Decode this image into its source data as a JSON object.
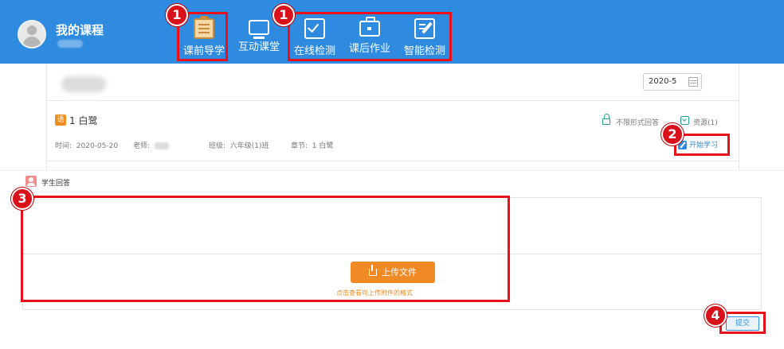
{
  "header": {
    "title": "我的课程",
    "nav": [
      {
        "label": "课前导学",
        "icon": "guide-clipboard-icon"
      },
      {
        "label": "互动课堂",
        "icon": "monitor-icon"
      },
      {
        "label": "在线检测",
        "icon": "checkbox-icon"
      },
      {
        "label": "课后作业",
        "icon": "briefcase-icon"
      },
      {
        "label": "智能检测",
        "icon": "edit-icon"
      }
    ],
    "bg_color": "#2e8be0"
  },
  "toolbar": {
    "date_value": "2020-5"
  },
  "lesson": {
    "subject_tag": "语",
    "name": "1 白鹭",
    "time_label": "时间:",
    "time_value": "2020-05-20",
    "teacher_label": "老师:",
    "class_label": "班级:",
    "class_value": "六年级(1)班",
    "chapter_label": "章节:",
    "chapter_value": "1 白鹭",
    "answer_mode": "不限形式回答",
    "resources": "资源(1)",
    "start_label": "开始学习"
  },
  "answer": {
    "section_label": "学生回答",
    "upload_label": "上传文件",
    "upload_hint": "点击查看可上传附件的格式"
  },
  "submit_label": "提交",
  "annotations": {
    "badge1": "1",
    "badge2": "2",
    "badge3": "3",
    "badge4": "4",
    "color": "#e8101a"
  }
}
